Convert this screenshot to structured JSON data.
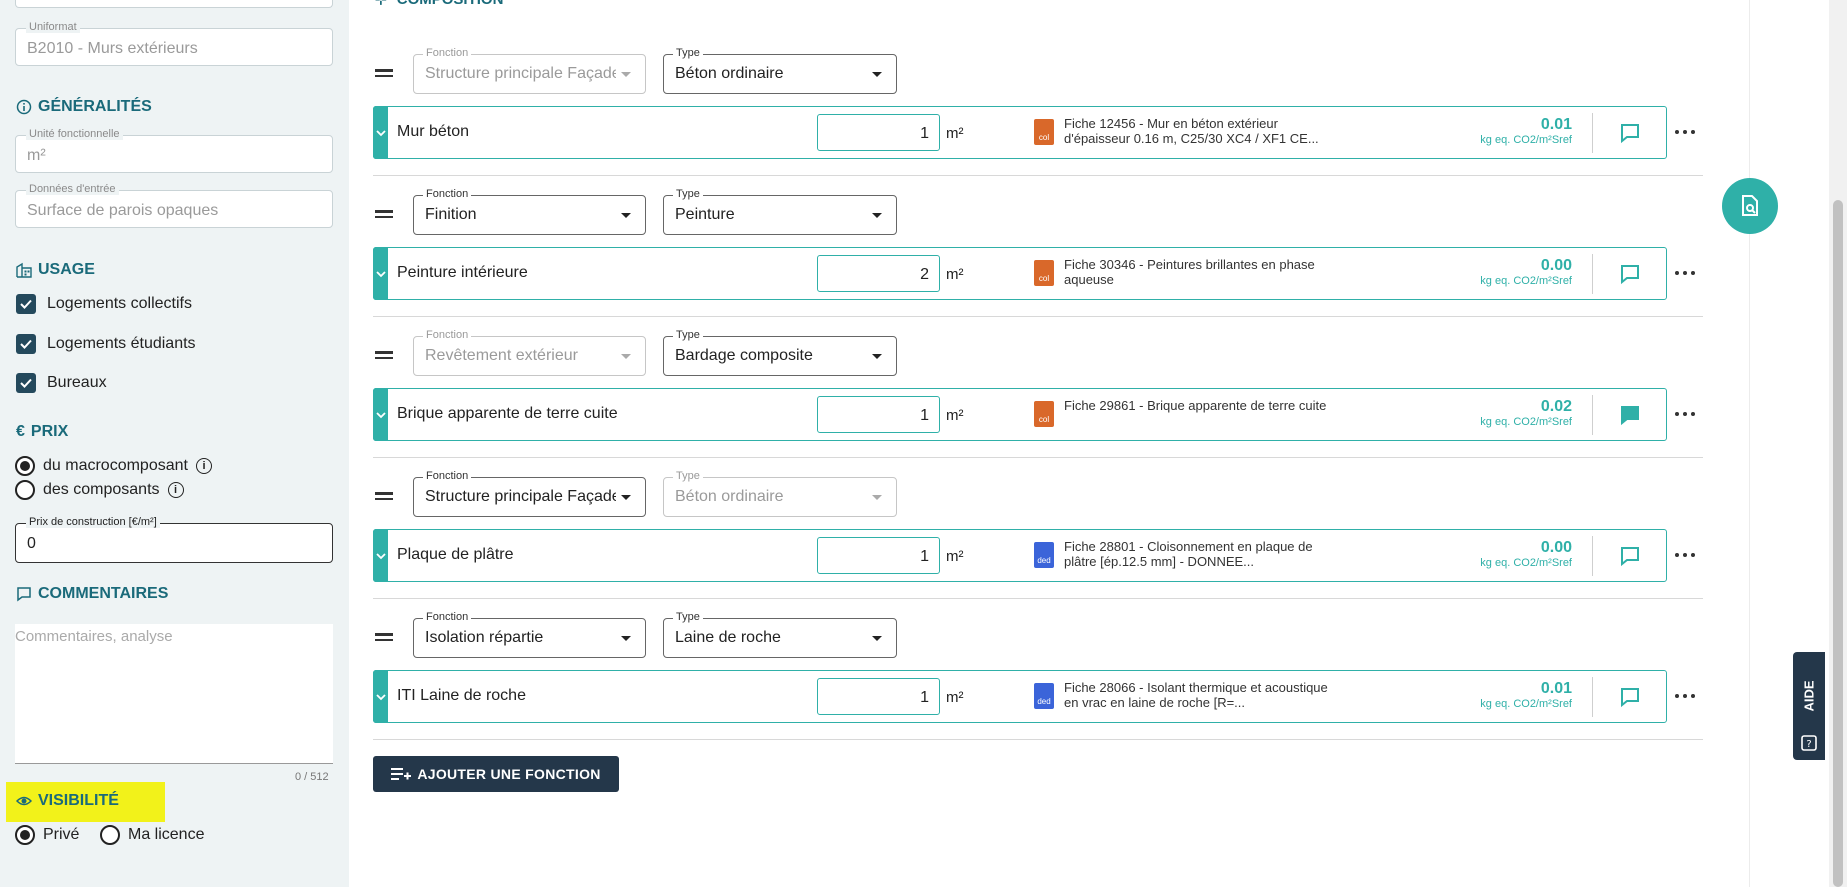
{
  "sidebar": {
    "uniformat": {
      "label": "Uniformat",
      "value": "B2010 - Murs extérieurs"
    },
    "generalites": {
      "title": "GÉNÉRALITÉS",
      "unite": {
        "label": "Unité fonctionnelle",
        "value": "m²"
      },
      "donnees": {
        "label": "Données d'entrée",
        "value": "Surface de parois opaques"
      }
    },
    "usage": {
      "title": "USAGE",
      "items": [
        {
          "label": "Logements collectifs",
          "checked": true
        },
        {
          "label": "Logements étudiants",
          "checked": true
        },
        {
          "label": "Bureaux",
          "checked": true
        }
      ]
    },
    "prix": {
      "title": "PRIX",
      "options": [
        {
          "label": "du macrocomposant",
          "selected": true
        },
        {
          "label": "des composants",
          "selected": false
        }
      ],
      "construction": {
        "label": "Prix de construction [€/m²]",
        "value": "0"
      }
    },
    "commentaires": {
      "title": "COMMENTAIRES",
      "placeholder": "Commentaires, analyse",
      "counter": "0 / 512"
    },
    "visibilite": {
      "title": "VISIBILITÉ",
      "options": [
        {
          "label": "Privé",
          "selected": true
        },
        {
          "label": "Ma licence",
          "selected": false
        }
      ]
    }
  },
  "main": {
    "section_title": "COMPOSITION",
    "functions": [
      {
        "fonction": {
          "label": "Fonction",
          "value": "Structure principale Façade",
          "disabled": true
        },
        "type": {
          "label": "Type",
          "value": "Béton ordinaire",
          "disabled": false
        },
        "component": {
          "name": "Mur béton",
          "qty": "1",
          "unit": "m²",
          "fiche_kind": "col",
          "fiche": "Fiche 12456 - Mur en béton extérieur d'épaisseur 0.16 m, C25/30 XC4 / XF1 CE...",
          "impact": "0.01",
          "impact_unit": "kg eq. CO2/m²Sref",
          "comment_filled": false
        }
      },
      {
        "fonction": {
          "label": "Fonction",
          "value": "Finition",
          "disabled": false
        },
        "type": {
          "label": "Type",
          "value": "Peinture",
          "disabled": false
        },
        "component": {
          "name": "Peinture intérieure",
          "qty": "2",
          "unit": "m²",
          "fiche_kind": "col",
          "fiche": "Fiche 30346 - Peintures brillantes en phase aqueuse",
          "impact": "0.00",
          "impact_unit": "kg eq. CO2/m²Sref",
          "comment_filled": false
        }
      },
      {
        "fonction": {
          "label": "Fonction",
          "value": "Revêtement extérieur",
          "disabled": true
        },
        "type": {
          "label": "Type",
          "value": "Bardage composite",
          "disabled": false
        },
        "component": {
          "name": "Brique apparente de terre cuite",
          "qty": "1",
          "unit": "m²",
          "fiche_kind": "col",
          "fiche": "Fiche 29861 - Brique apparente de terre cuite",
          "impact": "0.02",
          "impact_unit": "kg eq. CO2/m²Sref",
          "comment_filled": true
        }
      },
      {
        "fonction": {
          "label": "Fonction",
          "value": "Structure principale Façade",
          "disabled": false
        },
        "type": {
          "label": "Type",
          "value": "Béton ordinaire",
          "disabled": true
        },
        "component": {
          "name": "Plaque de plâtre",
          "qty": "1",
          "unit": "m²",
          "fiche_kind": "ded",
          "fiche": "Fiche 28801 - Cloisonnement en plaque de plâtre [ép.12.5 mm] - DONNEE...",
          "impact": "0.00",
          "impact_unit": "kg eq. CO2/m²Sref",
          "comment_filled": false
        }
      },
      {
        "fonction": {
          "label": "Fonction",
          "value": "Isolation répartie",
          "disabled": false
        },
        "type": {
          "label": "Type",
          "value": "Laine de roche",
          "disabled": false
        },
        "component": {
          "name": "ITI Laine de roche",
          "qty": "1",
          "unit": "m²",
          "fiche_kind": "ded",
          "fiche": "Fiche 28066 - Isolant thermique et acoustique en vrac en laine de roche [R=...",
          "impact": "0.01",
          "impact_unit": "kg eq. CO2/m²Sref",
          "comment_filled": false
        }
      }
    ],
    "add_button": "AJOUTER UNE FONCTION"
  },
  "aide_label": "AIDE",
  "colors": {
    "accent": "#2fb0a8",
    "dark": "#24374a",
    "title": "#1a6a7a",
    "highlight": "#f2f21a"
  },
  "icons": [
    "info-icon",
    "building-icon",
    "euro-icon",
    "comment-icon",
    "eye-icon",
    "document-search-icon",
    "help-icon",
    "chevron-down-icon",
    "drag-handle-icon",
    "more-icon",
    "playlist-add-icon"
  ]
}
